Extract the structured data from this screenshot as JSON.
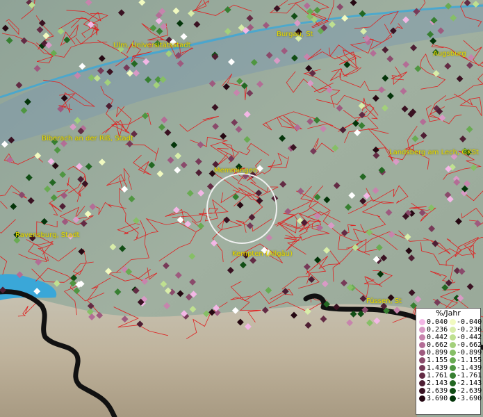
{
  "map": {
    "cities": [
      {
        "name": "Ulm, Universitätsstadt"
      },
      {
        "name": "Burgau, St"
      },
      {
        "name": "Augsburg"
      },
      {
        "name": "Biberach an der Riß, Stadt"
      },
      {
        "name": "Landsberg am Lech, GKSt"
      },
      {
        "name": "Memmingen"
      },
      {
        "name": "Ravensburg, Stadt"
      },
      {
        "name": "Kempten (Allgäu)"
      },
      {
        "name": "Füssen, St"
      }
    ],
    "colors": {
      "boundary": "#e02020",
      "coast": "#111111",
      "water": "#3aa7d8",
      "label": "#e6d800"
    }
  },
  "legend": {
    "title": "%/Jahr",
    "positive": [
      {
        "label": "0.040",
        "color": "#f3b7e6"
      },
      {
        "label": "0.236",
        "color": "#d99ac6"
      },
      {
        "label": "0.442",
        "color": "#c784ad"
      },
      {
        "label": "0.662",
        "color": "#b36d96"
      },
      {
        "label": "0.899",
        "color": "#9e5a7f"
      },
      {
        "label": "1.155",
        "color": "#8a4a6b"
      },
      {
        "label": "1.439",
        "color": "#773a58"
      },
      {
        "label": "1.761",
        "color": "#632b44"
      },
      {
        "label": "2.143",
        "color": "#4e1e33"
      },
      {
        "label": "2.639",
        "color": "#3a1222"
      },
      {
        "label": "3.690",
        "color": "#250812"
      }
    ],
    "negative": [
      {
        "label": "-0.040",
        "color": "#f1fac0"
      },
      {
        "label": "-0.236",
        "color": "#d8eda9"
      },
      {
        "label": "-0.442",
        "color": "#bfe090"
      },
      {
        "label": "-0.662",
        "color": "#a3d07b"
      },
      {
        "label": "-0.899",
        "color": "#86bf66"
      },
      {
        "label": "-1.155",
        "color": "#69ab52"
      },
      {
        "label": "-1.439",
        "color": "#4f9641"
      },
      {
        "label": "-1.761",
        "color": "#377f31"
      },
      {
        "label": "-2.143",
        "color": "#236722"
      },
      {
        "label": "-2.639",
        "color": "#114e15"
      },
      {
        "label": "-3.690",
        "color": "#04350a"
      }
    ]
  }
}
